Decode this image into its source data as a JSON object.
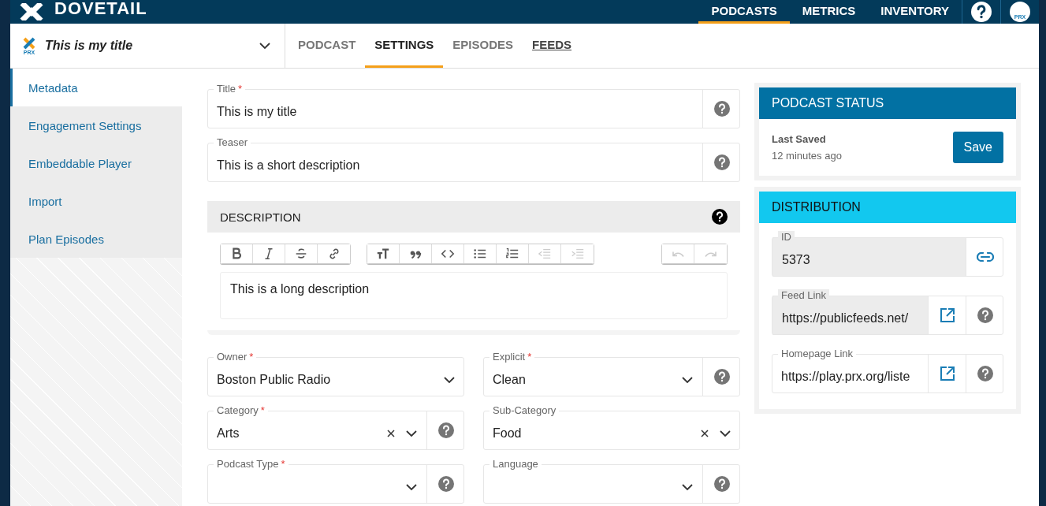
{
  "header": {
    "brand": "DOVETAIL",
    "nav": [
      {
        "label": "PODCASTS",
        "selected": true
      },
      {
        "label": "METRICS",
        "selected": false
      },
      {
        "label": "INVENTORY",
        "selected": false
      }
    ],
    "avatar_text": "PRX"
  },
  "podcast_selector": {
    "logo_text": "PRX",
    "title": "This is my title"
  },
  "tabs": [
    {
      "label": "PODCAST",
      "selected": false,
      "hovered": false
    },
    {
      "label": "SETTINGS",
      "selected": true,
      "hovered": false
    },
    {
      "label": "EPISODES",
      "selected": false,
      "hovered": false
    },
    {
      "label": "FEEDS",
      "selected": false,
      "hovered": true
    }
  ],
  "sidebar": {
    "items": [
      {
        "label": "Metadata",
        "selected": true
      },
      {
        "label": "Engagement Settings",
        "selected": false
      },
      {
        "label": "Embeddable Player",
        "selected": false
      },
      {
        "label": "Import",
        "selected": false
      },
      {
        "label": "Plan Episodes",
        "selected": false
      }
    ]
  },
  "required_mark": "*",
  "form": {
    "fields": [
      {
        "kind": "text",
        "label": "Title",
        "required": true,
        "value": "This is my title",
        "help": true
      },
      {
        "kind": "text",
        "label": "Teaser",
        "value": "This is a short description",
        "help": true
      }
    ],
    "description": {
      "heading": "DESCRIPTION",
      "value": "This is a long description",
      "toolbar": [
        [
          {
            "kind": "bold",
            "disabled": false
          },
          {
            "kind": "italic",
            "disabled": false
          },
          {
            "kind": "strike",
            "disabled": false
          },
          {
            "kind": "link",
            "disabled": false
          }
        ],
        [
          {
            "kind": "text-size",
            "disabled": false
          },
          {
            "kind": "quote",
            "disabled": false
          },
          {
            "kind": "code",
            "disabled": false
          },
          {
            "kind": "bullet-list",
            "disabled": false
          },
          {
            "kind": "number-list",
            "disabled": false
          },
          {
            "kind": "outdent",
            "disabled": true
          },
          {
            "kind": "indent",
            "disabled": true
          }
        ],
        [
          {
            "kind": "undo",
            "disabled": true
          },
          {
            "kind": "redo",
            "disabled": true
          }
        ]
      ]
    },
    "rows": [
      [
        {
          "kind": "select",
          "label": "Owner",
          "required": true,
          "value": "Boston Public Radio"
        },
        {
          "kind": "select",
          "label": "Explicit",
          "required": true,
          "value": "Clean",
          "help": true
        }
      ],
      [
        {
          "kind": "select",
          "label": "Category",
          "required": true,
          "value": "Arts",
          "clearable": true,
          "help": true
        },
        {
          "kind": "select",
          "label": "Sub-Category",
          "value": "Food",
          "clearable": true
        }
      ],
      [
        {
          "kind": "select",
          "label": "Podcast Type",
          "required": true,
          "help": true
        },
        {
          "kind": "select",
          "label": "Language",
          "help": true
        }
      ]
    ]
  },
  "status": {
    "heading": "PODCAST STATUS",
    "last_saved_label": "Last Saved",
    "last_saved_time": "12 minutes ago",
    "save": "Save"
  },
  "distribution": {
    "heading": "DISTRIBUTION",
    "fields": [
      {
        "label": "ID",
        "value": "5373",
        "readonly": true,
        "copy_link": true
      },
      {
        "label": "Feed Link",
        "value": "https://publicfeeds.net/",
        "readonly": true,
        "open_link": true,
        "help": true
      },
      {
        "label": "Homepage Link",
        "value": "https://play.prx.org/liste",
        "readonly": false,
        "open_link": true,
        "help": true
      }
    ]
  }
}
